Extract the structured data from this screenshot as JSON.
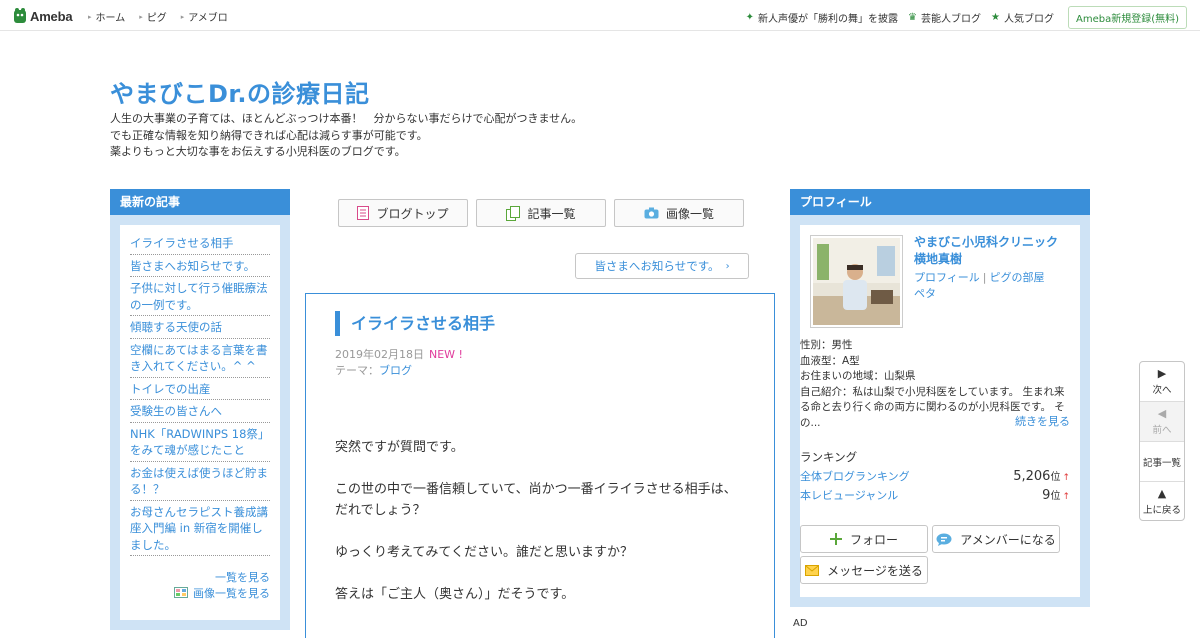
{
  "topbar": {
    "logo_text": "Ameba",
    "nav": [
      "ホーム",
      "ピグ",
      "アメブロ"
    ],
    "right_links": [
      {
        "label": "新人声優が「勝利の舞」を披露",
        "icon": "sparkle-icon"
      },
      {
        "label": "芸能人ブログ",
        "icon": "crown-icon"
      },
      {
        "label": "人気ブログ",
        "icon": "star-icon"
      }
    ],
    "signup_label": "Ameba新規登録(無料)"
  },
  "header": {
    "title": "やまびこDr.の診療日記",
    "desc_lines": [
      "人生の大事業の子育ては、ほとんどぶっつけ本番！　分からない事だらけで心配がつきません。",
      "でも正確な情報を知り納得できれば心配は減らす事が可能です。",
      "薬よりもっと大切な事をお伝えする小児科医のブログです。"
    ]
  },
  "left": {
    "heading": "最新の記事",
    "items": [
      "イライラさせる相手",
      "皆さまへお知らせです。",
      "子供に対して行う催眠療法の一例です。",
      "傾聴する天使の話",
      "空欄にあてはまる言葉を書き入れてください。^ ^",
      "トイレでの出産",
      "受験生の皆さんへ",
      "NHK「RADWINPS 18祭」をみて魂が感じたこと",
      "お金は使えば使うほど貯まる！？",
      "お母さんセラピスト養成講座入門編 in 新宿を開催しました。"
    ],
    "list_link": "一覧を見る",
    "image_list_link": "画像一覧を見る"
  },
  "middle": {
    "buttons": [
      "ブログトップ",
      "記事一覧",
      "画像一覧"
    ],
    "next_entry": "皆さまへお知らせです。",
    "article": {
      "title": "イライラさせる相手",
      "date": "2019年02月18日",
      "new_badge": "NEW !",
      "theme_label": "テーマ：",
      "theme": "ブログ",
      "paragraphs": [
        "突然ですが質問です。",
        "この世の中で一番信頼していて、尚かつ一番イライラさせる相手は、だれでしょう？",
        "ゆっくり考えてみてください。誰だと思いますか？",
        "答えは「ご主人（奥さん）」だそうです。"
      ]
    }
  },
  "right": {
    "heading": "プロフィール",
    "name": "やまびこ小児科クリニック　横地真樹",
    "links": [
      "プロフィール",
      "ピグの部屋",
      "ペタ"
    ],
    "info": [
      "性別：男性",
      "血液型：A型",
      "お住まいの地域：山梨県",
      "自己紹介：私は山梨で小児科医をしています。 生まれ来る命と去り行く命の両方に関わるのが小児科医です。 その..."
    ],
    "more_link": "続きを見る",
    "ranking_heading": "ランキング",
    "rankings": [
      {
        "label": "全体ブログランキング",
        "value": "5,206",
        "unit": "位",
        "trend": "↑"
      },
      {
        "label": "本レビュージャンル",
        "value": "9",
        "unit": "位",
        "trend": "↑"
      }
    ],
    "follow_label": "フォロー",
    "amember_label": "アメンバーになる",
    "message_label": "メッセージを送る"
  },
  "ad_label": "AD",
  "floatnav": [
    "次へ",
    "前へ",
    "記事一覧",
    "上に戻る"
  ],
  "colors": {
    "accent": "#3a8fd9",
    "ameba_green": "#2d8c3c",
    "new_badge": "#e03c9c"
  }
}
